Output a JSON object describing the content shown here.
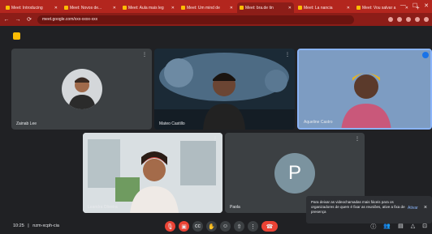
{
  "browser": {
    "tabs": [
      {
        "label": "Meet: Introducing"
      },
      {
        "label": "Meet: Novos de..."
      },
      {
        "label": "Meet: Aula mais leg"
      },
      {
        "label": "Meet: Um mind de"
      },
      {
        "label": "Meet: bra.de tin"
      },
      {
        "label": "Meet: La nancia"
      },
      {
        "label": "Meet: Vou salvar a"
      }
    ],
    "new_tab": "+",
    "url": "meet.google.com/xxx-xxxx-xxx"
  },
  "tiles": [
    {
      "name": "Zainab Lee"
    },
    {
      "name": "Mateo Castillo"
    },
    {
      "name": "Aqueline Castro"
    },
    {
      "name": "Leandra Oliveira"
    },
    {
      "name": "Paola",
      "initial": "P"
    }
  ],
  "toast": {
    "message": "Para deixar as videochamadas mais fáceis para os organizadores de quem é fixar as reuniões, ative a fixa de presença",
    "action": "Ativar",
    "close": "×"
  },
  "bottom": {
    "time": "10:25",
    "code": "nzm-xcph-cia"
  },
  "colors": {
    "browser_accent": "#b3261e",
    "meet_bg": "#202124",
    "hangup": "#ea4335"
  }
}
